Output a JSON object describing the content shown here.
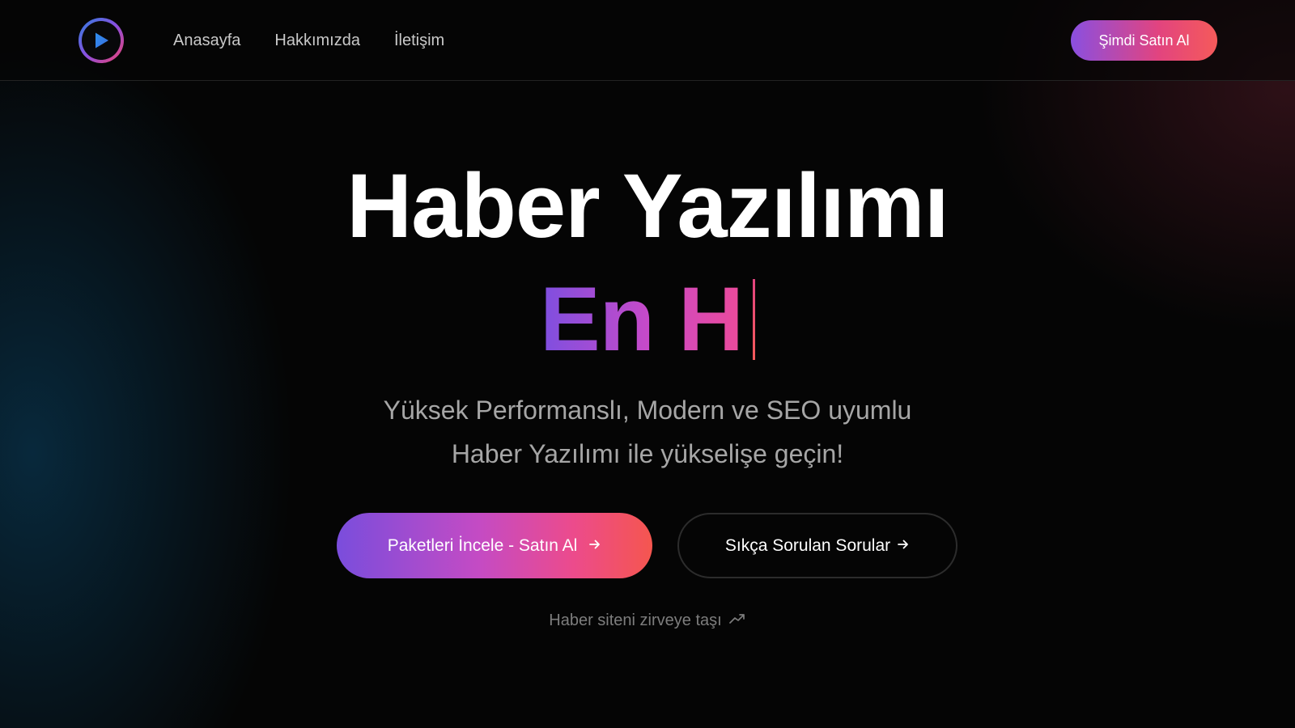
{
  "colors": {
    "background": "#050505",
    "gradient_start": "#7d4fe0",
    "gradient_mid": "#c94ac8",
    "gradient_end": "#f55a5a",
    "nav_text": "#c9c9c9",
    "subtitle_text": "#a6a6a6"
  },
  "header": {
    "logo_icon": "play-circle-icon",
    "nav": [
      {
        "label": "Anasayfa"
      },
      {
        "label": "Hakkımızda"
      },
      {
        "label": "İletişim"
      }
    ],
    "buy_button": "Şimdi Satın Al"
  },
  "hero": {
    "title": "Haber Yazılımı",
    "typed_text": "En H",
    "subtitle_line1": "Yüksek Performanslı, Modern ve SEO uyumlu",
    "subtitle_line2": "Haber Yazılımı ile yükselişe geçin!",
    "primary_cta": "Paketleri İncele - Satın Al",
    "secondary_cta": "Sıkça Sorulan Sorular",
    "tagline": "Haber siteni zirveye taşı",
    "tagline_icon": "trending-up-icon",
    "cta_icon": "arrow-right-icon"
  }
}
